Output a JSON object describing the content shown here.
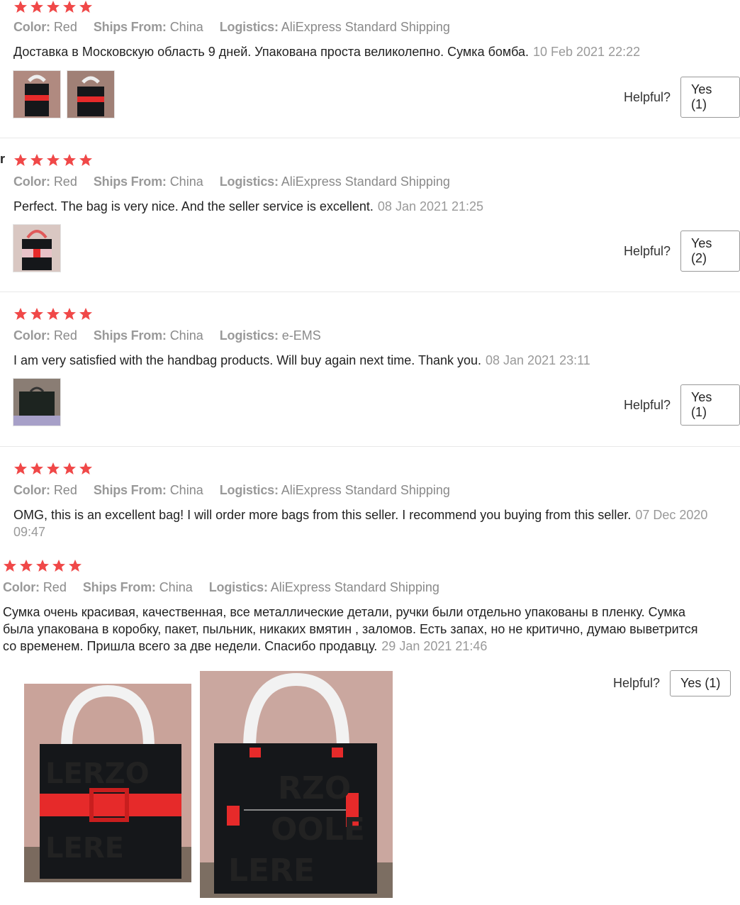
{
  "reviews": [
    {
      "color_label": "Color:",
      "color": "Red",
      "ships_label": "Ships From:",
      "ships": "China",
      "logistics_label": "Logistics:",
      "logistics": "AliExpress Standard Shipping",
      "text": "Доставка в Московскую область 9 дней. Упакована проста великолепно. Сумка бомба.",
      "date": "10 Feb 2021 22:22",
      "helpful": "Helpful?",
      "yes": "Yes (1)"
    },
    {
      "name_stub": "r",
      "color_label": "Color:",
      "color": "Red",
      "ships_label": "Ships From:",
      "ships": "China",
      "logistics_label": "Logistics:",
      "logistics": "AliExpress Standard Shipping",
      "text": "Perfect. The bag is very nice. And the seller service is excellent.",
      "date": "08 Jan 2021 21:25",
      "helpful": "Helpful?",
      "yes": "Yes (2)"
    },
    {
      "color_label": "Color:",
      "color": "Red",
      "ships_label": "Ships From:",
      "ships": "China",
      "logistics_label": "Logistics:",
      "logistics": "e-EMS",
      "text": "I am very satisfied with the handbag products. Will buy again next time. Thank you.",
      "date": "08 Jan 2021 23:11",
      "helpful": "Helpful?",
      "yes": "Yes (1)"
    },
    {
      "color_label": "Color:",
      "color": "Red",
      "ships_label": "Ships From:",
      "ships": "China",
      "logistics_label": "Logistics:",
      "logistics": "AliExpress Standard Shipping",
      "text": "OMG, this is an excellent bag! I will order more bags from this seller. I recommend you buying from this seller.",
      "date": "07 Dec 2020 09:47"
    },
    {
      "color_label": "Color:",
      "color": "Red",
      "ships_label": "Ships From:",
      "ships": "China",
      "logistics_label": "Logistics:",
      "logistics": "AliExpress Standard Shipping",
      "text": "Сумка очень красивая, качественная, все металлические детали, ручки были отдельно упакованы в пленку. Сумка была упакована в коробку, пакет, пыльник, никаких вмятин , заломов. Есть запах, но не критично, думаю выветрится со временем. Пришла всего за две недели. Спасибо продавцу.",
      "date": "29 Jan 2021 21:46",
      "helpful": "Helpful?",
      "yes": "Yes (1)"
    }
  ],
  "rating": 5,
  "colors": {
    "star": "#f04848",
    "bag": "#15171a",
    "strap": "#e62a2a",
    "wrap": "#f2f2f2",
    "wall": "#c9a39a"
  }
}
